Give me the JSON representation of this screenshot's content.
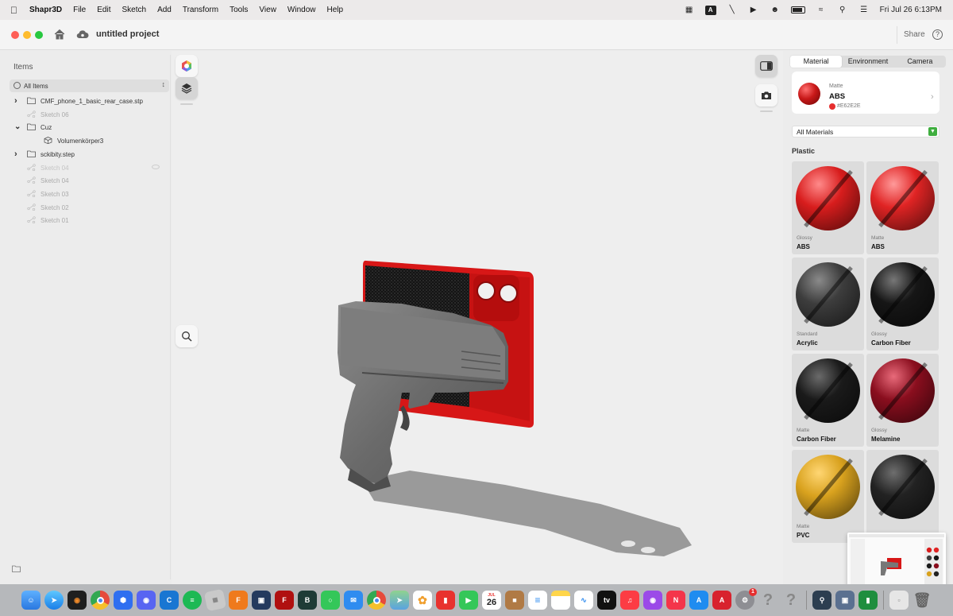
{
  "menubar": {
    "app_name": "Shapr3D",
    "menus": [
      "File",
      "Edit",
      "Sketch",
      "Add",
      "Transform",
      "Tools",
      "View",
      "Window",
      "Help"
    ],
    "clock": "Fri Jul 26  6:13PM"
  },
  "window": {
    "project_title": "untitled project",
    "share_label": "Share",
    "help_label": "?"
  },
  "items_panel": {
    "heading": "Items",
    "filter_label": "All Items",
    "tree": [
      {
        "label": "CMF_phone_1_basic_rear_case.stp",
        "type": "folder",
        "expand": "collapsed",
        "indent": 0,
        "dim": false
      },
      {
        "label": "Sketch 06",
        "type": "sketch",
        "expand": "none",
        "indent": 0,
        "dim": true
      },
      {
        "label": "Cuz",
        "type": "folder",
        "expand": "expanded",
        "indent": 0,
        "dim": false
      },
      {
        "label": "Volumenkörper3",
        "type": "body",
        "expand": "none",
        "indent": 1,
        "dim": false
      },
      {
        "label": "sckibity.step",
        "type": "folder",
        "expand": "collapsed",
        "indent": 0,
        "dim": false
      },
      {
        "label": "Sketch 04",
        "type": "sketch",
        "expand": "none",
        "indent": 0,
        "dim": true,
        "hidden": true
      },
      {
        "label": "Sketch 04",
        "type": "sketch",
        "expand": "none",
        "indent": 0,
        "dim": true
      },
      {
        "label": "Sketch 03",
        "type": "sketch",
        "expand": "none",
        "indent": 0,
        "dim": true
      },
      {
        "label": "Sketch 02",
        "type": "sketch",
        "expand": "none",
        "indent": 0,
        "dim": true
      },
      {
        "label": "Sketch 01",
        "type": "sketch",
        "expand": "none",
        "indent": 0,
        "dim": true
      }
    ]
  },
  "material_panel": {
    "tabs": [
      "Material",
      "Environment",
      "Camera"
    ],
    "active_tab": "Material",
    "current": {
      "finish": "Matte",
      "name": "ABS",
      "hex": "#E62E2E"
    },
    "library_select": "All Materials",
    "section": "Plastic",
    "materials": [
      {
        "finish": "Glossy",
        "name": "ABS",
        "color": "#d81d1d",
        "highlight": "#ff8a8a"
      },
      {
        "finish": "Matte",
        "name": "ABS",
        "color": "#e02424",
        "highlight": "#ff9a9a"
      },
      {
        "finish": "Standard",
        "name": "Acrylic",
        "color": "#3d3d3d",
        "highlight": "#8a8a8a"
      },
      {
        "finish": "Glossy",
        "name": "Carbon Fiber",
        "color": "#161616",
        "highlight": "#777777"
      },
      {
        "finish": "Matte",
        "name": "Carbon Fiber",
        "color": "#1a1a1a",
        "highlight": "#6a6a6a"
      },
      {
        "finish": "Glossy",
        "name": "Melamine",
        "color": "#8a0e1e",
        "highlight": "#e86a7a"
      },
      {
        "finish": "Matte",
        "name": "PVC",
        "color": "#d9a21e",
        "highlight": "#ffd673"
      },
      {
        "finish": "",
        "name": "",
        "color": "#222222",
        "highlight": "#6e6e6e"
      }
    ]
  },
  "dock": {
    "calendar_month": "JUL",
    "calendar_day": "26",
    "settings_badge": "1"
  }
}
